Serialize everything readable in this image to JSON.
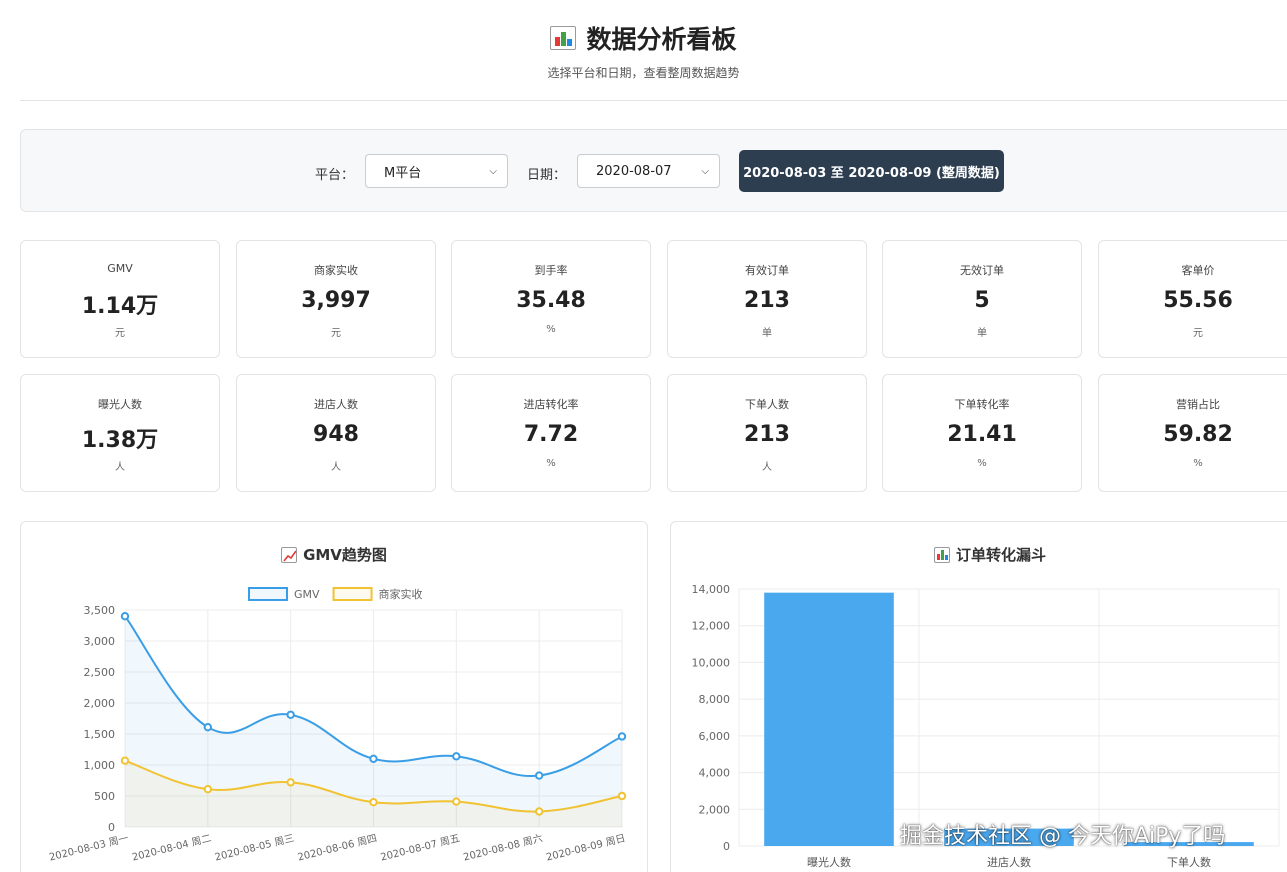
{
  "header": {
    "title": "数据分析看板",
    "subtitle": "选择平台和日期，查看整周数据趋势",
    "title_icon": "bar-chart-icon"
  },
  "filters": {
    "platform_label": "平台：",
    "platform_value": "M平台",
    "date_label": "日期：",
    "date_value": "2020-08-07",
    "week_button": "2020-08-03 至 2020-08-09 (整周数据)"
  },
  "metrics_row1": [
    {
      "label": "GMV",
      "value": "1.14万",
      "unit": "元"
    },
    {
      "label": "商家实收",
      "value": "3,997",
      "unit": "元"
    },
    {
      "label": "到手率",
      "value": "35.48",
      "unit": "%"
    },
    {
      "label": "有效订单",
      "value": "213",
      "unit": "单"
    },
    {
      "label": "无效订单",
      "value": "5",
      "unit": "单"
    },
    {
      "label": "客单价",
      "value": "55.56",
      "unit": "元"
    }
  ],
  "metrics_row2": [
    {
      "label": "曝光人数",
      "value": "1.38万",
      "unit": "人"
    },
    {
      "label": "进店人数",
      "value": "948",
      "unit": "人"
    },
    {
      "label": "进店转化率",
      "value": "7.72",
      "unit": "%"
    },
    {
      "label": "下单人数",
      "value": "213",
      "unit": "人"
    },
    {
      "label": "下单转化率",
      "value": "21.41",
      "unit": "%"
    },
    {
      "label": "营销占比",
      "value": "59.82",
      "unit": "%"
    }
  ],
  "gmv_panel": {
    "title": "GMV趋势图",
    "icon": "line-chart-icon"
  },
  "funnel_panel": {
    "title": "订单转化漏斗",
    "icon": "bar-chart-icon"
  },
  "chart_data": [
    {
      "type": "line",
      "title": "GMV趋势图",
      "x": [
        "2020-08-03 周一",
        "2020-08-04 周二",
        "2020-08-05 周三",
        "2020-08-06 周四",
        "2020-08-07 周五",
        "2020-08-08 周六",
        "2020-08-09 周日"
      ],
      "series": [
        {
          "name": "GMV",
          "values": [
            3400,
            1610,
            1810,
            1100,
            1140,
            830,
            1460
          ],
          "color": "#3a9ee6",
          "fill": "rgba(58,158,230,0.08)"
        },
        {
          "name": "商家实收",
          "values": [
            1070,
            610,
            720,
            400,
            410,
            250,
            500
          ],
          "color": "#f1c232",
          "fill": "rgba(241,194,50,0.08)"
        }
      ],
      "ylim": [
        0,
        3500
      ],
      "yticks": [
        "0",
        "500",
        "1,000",
        "1,500",
        "2,000",
        "2,500",
        "3,000",
        "3,500"
      ],
      "legend": "top",
      "grid": true
    },
    {
      "type": "bar",
      "title": "订单转化漏斗",
      "categories": [
        "曝光人数",
        "进店人数",
        "下单人数"
      ],
      "values": [
        13800,
        948,
        213
      ],
      "color": "#4aa8ee",
      "ylim": [
        0,
        14000
      ],
      "yticks": [
        "0",
        "2,000",
        "4,000",
        "6,000",
        "8,000",
        "10,000",
        "12,000",
        "14,000"
      ],
      "grid": true
    }
  ],
  "watermark": "掘金技术社区 @ 今天你AiPy了吗"
}
